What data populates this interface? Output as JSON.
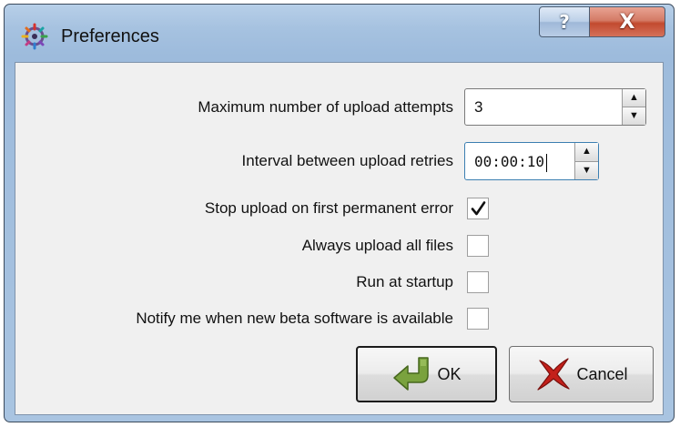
{
  "window": {
    "title": "Preferences",
    "help_label": "?",
    "close_label": "X",
    "app_icon": "wheel-icon"
  },
  "form": {
    "max_attempts": {
      "label": "Maximum number of upload attempts",
      "value": "3"
    },
    "retry_interval": {
      "label": "Interval between upload retries",
      "value": "00:00:10"
    },
    "stop_on_error": {
      "label": "Stop upload on first permanent error",
      "checked": true
    },
    "upload_all": {
      "label": "Always upload all files",
      "checked": false
    },
    "run_at_startup": {
      "label": "Run at startup",
      "checked": false
    },
    "notify_beta": {
      "label": "Notify me when new beta software is available",
      "checked": false
    },
    "spin_up_glyph": "▲",
    "spin_down_glyph": "▼"
  },
  "buttons": {
    "ok": {
      "label": "OK",
      "icon": "arrow-enter-icon"
    },
    "cancel": {
      "label": "Cancel",
      "icon": "red-x-icon"
    }
  },
  "colors": {
    "title_bar": "#a6c2e0",
    "close_button": "#c24a2f",
    "client_background": "#f0f0f0",
    "focus_border": "#3c7fb1",
    "ok_arrow": "#7aa23e",
    "cancel_x": "#c4201b"
  }
}
